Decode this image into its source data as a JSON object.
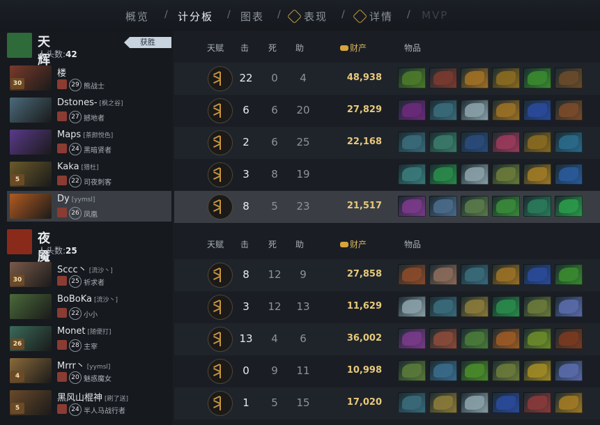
{
  "nav": {
    "tabs": [
      {
        "label": "概览"
      },
      {
        "label": "计分板",
        "active": true
      },
      {
        "label": "图表"
      },
      {
        "label": "表现",
        "icon": "plus-shield-icon"
      },
      {
        "label": "详情",
        "icon": "plus-shield-icon"
      },
      {
        "label": "MVP",
        "disabled": true
      }
    ],
    "separator": "/"
  },
  "columns": {
    "talent": "天赋",
    "kills": "击",
    "deaths": "死",
    "assists": "助",
    "net_worth": "财产",
    "items": "物品"
  },
  "teams": [
    {
      "name": "天辉",
      "kills_label": "人头数:",
      "kills": "42",
      "result": "获胜",
      "icon_color": "#2f6a3a",
      "players": [
        {
          "name": "楼",
          "tag": "",
          "level": "30",
          "hero_level": "29",
          "hero": "熊战士",
          "k": "22",
          "d": "0",
          "a": "4",
          "nw": "48,938",
          "portrait": "#7a3a2a",
          "items": [
            "#4c7a2a",
            "#7a3a30",
            "#a07025",
            "#8a6a20",
            "#3a8a30",
            "#6a4a2a"
          ]
        },
        {
          "name": "Dstones-",
          "tag": "[枫之谷]",
          "level": "",
          "hero_level": "27",
          "hero": "撼地者",
          "k": "6",
          "d": "6",
          "a": "20",
          "nw": "27,829",
          "portrait": "#4a6a7a",
          "items": [
            "#6a2a7a",
            "#3a6a7a",
            "#8aa0a8",
            "#9a7025",
            "#2a4a9a",
            "#7a4a2a"
          ]
        },
        {
          "name": "Maps",
          "tag": "[茶颜悦色]",
          "level": "",
          "hero_level": "24",
          "hero": "黑暗贤者",
          "k": "2",
          "d": "6",
          "a": "25",
          "nw": "22,168",
          "portrait": "#5a3a8a",
          "items": [
            "#3a6a7a",
            "#3a7a6a",
            "#2a4a7a",
            "#9a3a5a",
            "#8a6a20",
            "#2a6a8a"
          ]
        },
        {
          "name": "Kaka",
          "tag": "[猎杜]",
          "level": "5",
          "hero_level": "22",
          "hero": "司夜刺客",
          "k": "3",
          "d": "8",
          "a": "19",
          "nw": "",
          "portrait": "#6a5a2a",
          "items": [
            "#3a7a7a",
            "#2a8a4a",
            "#8aa0a8",
            "#6a7a3a",
            "#a07a25",
            "#2a5a9a"
          ]
        },
        {
          "name": "Dy",
          "tag": "[yymsl]",
          "level": "",
          "hero_level": "26",
          "hero": "凤凰",
          "k": "8",
          "d": "5",
          "a": "23",
          "nw": "21,517",
          "portrait": "#b05a20",
          "selected": true,
          "items": [
            "#7a3a8a",
            "#4a6a8a",
            "#5a7a4a",
            "#3a8a3a",
            "#2a7a5a",
            "#2a9a4a"
          ]
        }
      ]
    },
    {
      "name": "夜魇",
      "kills_label": "人头数:",
      "kills": "25",
      "result": "",
      "icon_color": "#8a2a1a",
      "players": [
        {
          "name": "Sccc丶",
          "tag": "[流沙丶]",
          "level": "30",
          "hero_level": "25",
          "hero": "祈求者",
          "k": "8",
          "d": "12",
          "a": "9",
          "nw": "27,858",
          "portrait": "#7a5a4a",
          "items": [
            "#8a4a2a",
            "#8a6a5a",
            "#3a6a7a",
            "#9a7025",
            "#2a4a9a",
            "#3a8a30"
          ]
        },
        {
          "name": "BoBoKa",
          "tag": "[流沙丶]",
          "level": "",
          "hero_level": "22",
          "hero": "小小",
          "k": "3",
          "d": "12",
          "a": "13",
          "nw": "11,629",
          "portrait": "#4a6a3a",
          "items": [
            "#8aa0a8",
            "#3a6a7a",
            "#8a7a3a",
            "#2a8a4a",
            "#6a7a3a",
            "#5a6aaa"
          ]
        },
        {
          "name": "Monet",
          "tag": "[随便打]",
          "level": "26",
          "hero_level": "28",
          "hero": "主宰",
          "k": "13",
          "d": "4",
          "a": "6",
          "nw": "36,002",
          "portrait": "#3a6a5a",
          "items": [
            "#7a3a8a",
            "#8a4a3a",
            "#4a7a3a",
            "#9a5a25",
            "#6a8a2a",
            "#7a3a20"
          ]
        },
        {
          "name": "Mrrr丶",
          "tag": "[yymsl]",
          "level": "4",
          "hero_level": "20",
          "hero": "魅惑魔女",
          "k": "0",
          "d": "9",
          "a": "11",
          "nw": "10,998",
          "portrait": "#8a6a3a",
          "items": [
            "#5a7a3a",
            "#3a6a8a",
            "#4a8a2a",
            "#6a7a3a",
            "#a08a25",
            "#5a6aaa"
          ]
        },
        {
          "name": "黑风山棍神",
          "tag": "[刷了送]",
          "level": "5",
          "hero_level": "24",
          "hero": "半人马战行者",
          "k": "1",
          "d": "5",
          "a": "15",
          "nw": "17,020",
          "portrait": "#6a4a2a",
          "items": [
            "#3a6a7a",
            "#8a7a3a",
            "#8aa0a8",
            "#2a4a9a",
            "#8a3a3a",
            "#a07a25"
          ]
        }
      ]
    }
  ]
}
